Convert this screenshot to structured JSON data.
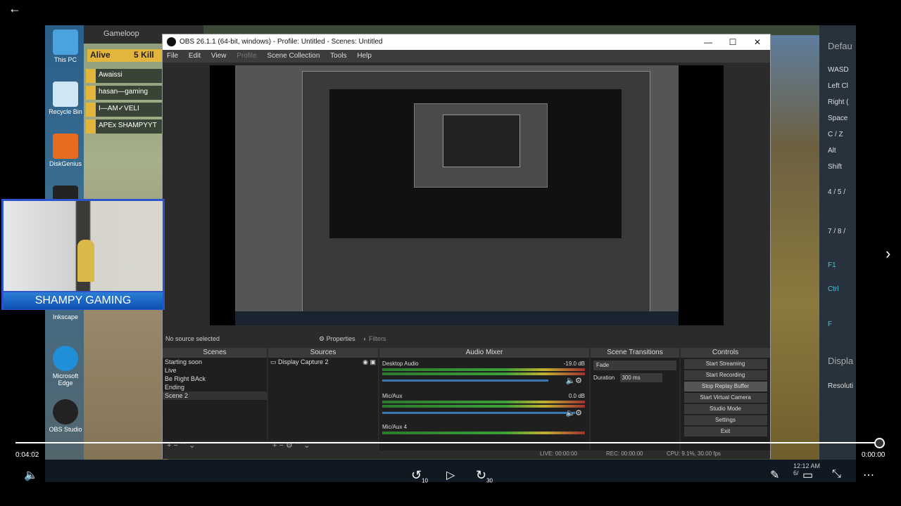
{
  "obs": {
    "title": "OBS 26.1.1 (64-bit, windows) - Profile: Untitled - Scenes: Untitled",
    "menu": [
      "File",
      "Edit",
      "View",
      "Profile",
      "Scene Collection",
      "Tools",
      "Help"
    ],
    "no_source": "No source selected",
    "properties_btn": "Properties",
    "filters_btn": "Filters",
    "scenes_header": "Scenes",
    "scenes": [
      "Starting soon",
      "Live",
      "Be Right BAck",
      "Ending",
      "Scene 2"
    ],
    "sources_header": "Sources",
    "sources": [
      "Display Capture 2"
    ],
    "mixer_header": "Audio Mixer",
    "mixer": [
      {
        "name": "Desktop Audio",
        "db": "-19.0 dB"
      },
      {
        "name": "Mic/Aux",
        "db": "0.0 dB"
      },
      {
        "name": "Mic/Aux 4",
        "db": ""
      }
    ],
    "transitions_header": "Scene Transitions",
    "transition": "Fade",
    "duration_label": "Duration",
    "duration_value": "300 ms",
    "controls_header": "Controls",
    "controls": [
      "Start Streaming",
      "Start Recording",
      "Stop Replay Buffer",
      "Start Virtual Camera",
      "Studio Mode",
      "Settings",
      "Exit"
    ],
    "status_live": "LIVE: 00:00:00",
    "status_rec": "REC: 00:00:00",
    "status_cpu": "CPU: 9.1%, 30.00 fps"
  },
  "desktop": {
    "gameloop": "Gameloop",
    "alive": "Alive",
    "alive_count": "5",
    "kill_label": "Kill",
    "killfeed": [
      "Awaissi",
      "hasan—gaming",
      "I—AM✓VELI",
      "APEx SHAMPYYT"
    ],
    "icons": [
      "This PC",
      "Recycle Bin",
      "DiskGenius",
      "Inkscape",
      "Microsoft Edge",
      "OBS Studio"
    ],
    "right_panel": [
      "Defau",
      "WASD",
      "Left Cl",
      "Right (",
      "Space",
      "C / Z",
      "Alt",
      "Shift",
      "4 / 5 /",
      "7 / 8 /",
      "F1",
      "Ctrl",
      "F",
      "Displa",
      "Resoluti"
    ],
    "clock_time": "12:12 AM",
    "clock_date": "6/"
  },
  "webcam": {
    "caption": "SHAMPY GAMING"
  },
  "player": {
    "current_time": "0:04:02",
    "total_time": "0:00:00",
    "rewind_label": "10",
    "forward_label": "30",
    "progress": 0.994
  }
}
